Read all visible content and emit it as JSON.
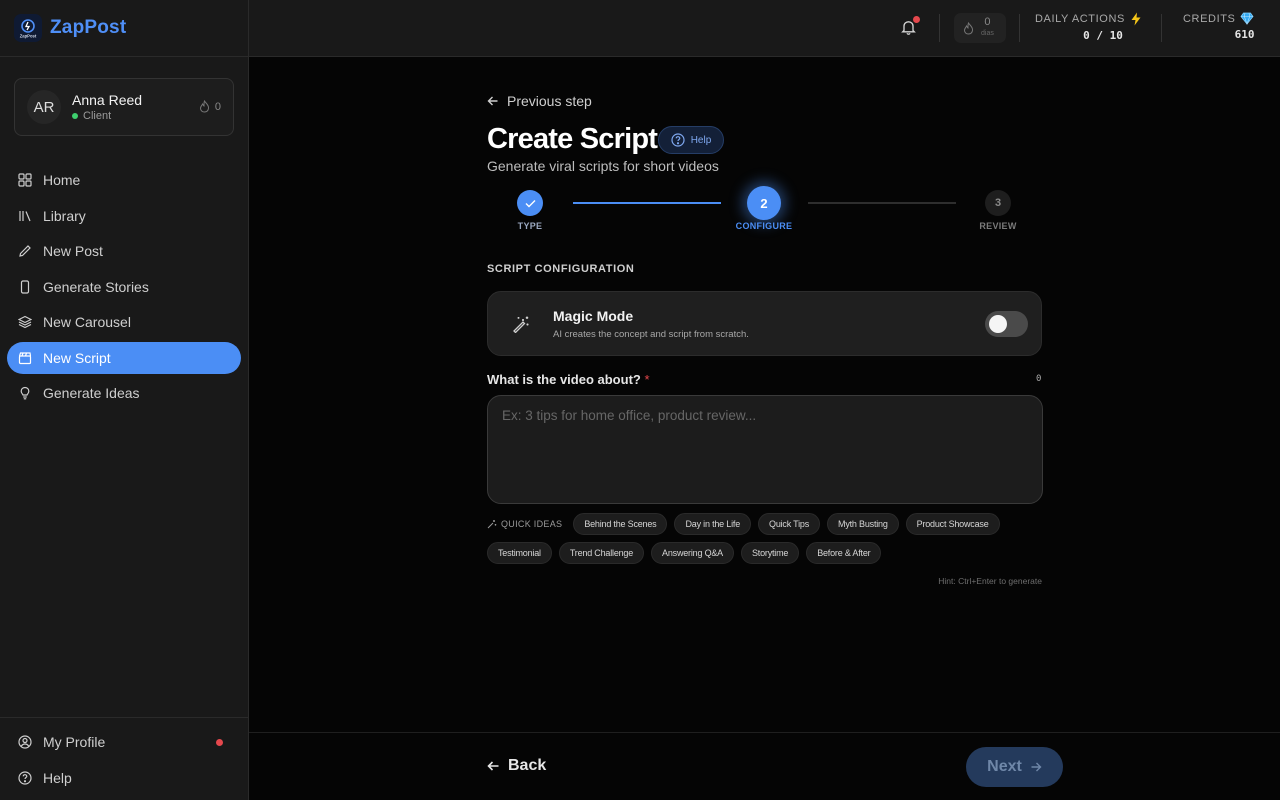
{
  "app": {
    "name": "ZapPost",
    "logo_text": "ZapPost"
  },
  "user": {
    "initials": "AR",
    "name": "Anna Reed",
    "role": "Client",
    "streak": "0"
  },
  "sidebar": {
    "items": [
      {
        "label": "Home",
        "icon": "grid-icon"
      },
      {
        "label": "Library",
        "icon": "library-icon"
      },
      {
        "label": "New Post",
        "icon": "pencil-icon"
      },
      {
        "label": "Generate Stories",
        "icon": "phone-icon"
      },
      {
        "label": "New Carousel",
        "icon": "layers-icon"
      },
      {
        "label": "New Script",
        "icon": "clapperboard-icon",
        "active": true
      },
      {
        "label": "Generate Ideas",
        "icon": "lightbulb-icon"
      }
    ],
    "bottom": [
      {
        "label": "My Profile",
        "icon": "user-circle-icon"
      },
      {
        "label": "Help",
        "icon": "help-circle-icon"
      }
    ]
  },
  "header": {
    "streak_value": "0",
    "streak_label": "dias",
    "daily_actions_label": "DAILY ACTIONS",
    "daily_actions_value": "0 / 10",
    "credits_label": "CREDITS",
    "credits_value": "610"
  },
  "page": {
    "previous_step": "Previous step",
    "title": "Create Script",
    "help": "Help",
    "subtitle": "Generate viral scripts for short videos"
  },
  "stepper": {
    "steps": [
      {
        "number": "1",
        "label": "TYPE",
        "state": "done"
      },
      {
        "number": "2",
        "label": "CONFIGURE",
        "state": "active"
      },
      {
        "number": "3",
        "label": "REVIEW",
        "state": "pending"
      }
    ]
  },
  "config": {
    "section_title": "SCRIPT CONFIGURATION",
    "magic_title": "Magic Mode",
    "magic_desc": "AI creates the concept and script from scratch.",
    "magic_enabled": false,
    "question": "What is the video about?",
    "required_mark": "*",
    "char_count": "0",
    "placeholder": "Ex: 3 tips for home office, product review...",
    "value": "",
    "quick_ideas_label": "QUICK IDEAS",
    "quick_ideas_row1": [
      "Behind the Scenes",
      "Day in the Life",
      "Quick Tips",
      "Myth Busting",
      "Product Showcase"
    ],
    "quick_ideas_row2": [
      "Testimonial",
      "Trend Challenge",
      "Answering Q&A",
      "Storytime",
      "Before & After"
    ],
    "hint": "Hint: Ctrl+Enter to generate"
  },
  "footer": {
    "back": "Back",
    "next": "Next"
  },
  "colors": {
    "accent": "#4b8ef5",
    "brand": "#4f8ff7",
    "danger": "#e5484d",
    "online": "#3ecf6e"
  }
}
